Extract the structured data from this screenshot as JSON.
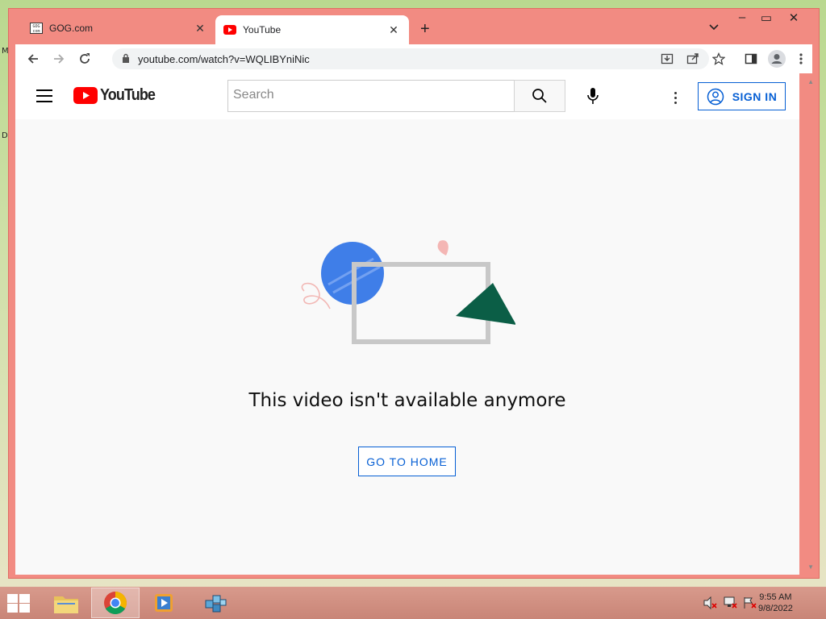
{
  "desktop": {
    "left_labels": [
      "M",
      "D"
    ]
  },
  "browser": {
    "tabs": [
      {
        "label": "GOG.com",
        "active": false
      },
      {
        "label": "YouTube",
        "active": true
      }
    ],
    "address": "youtube.com/watch?v=WQLIBYniNic"
  },
  "youtube": {
    "logo_text": "YouTube",
    "search_placeholder": "Search",
    "signin_label": "SIGN IN",
    "message": "This video isn't available anymore",
    "home_button": "GO TO HOME",
    "colors": {
      "brand_red": "#ff0000",
      "link_blue": "#065fd4"
    }
  },
  "taskbar": {
    "clock_time": "9:55 AM",
    "clock_date": "9/8/2022"
  }
}
